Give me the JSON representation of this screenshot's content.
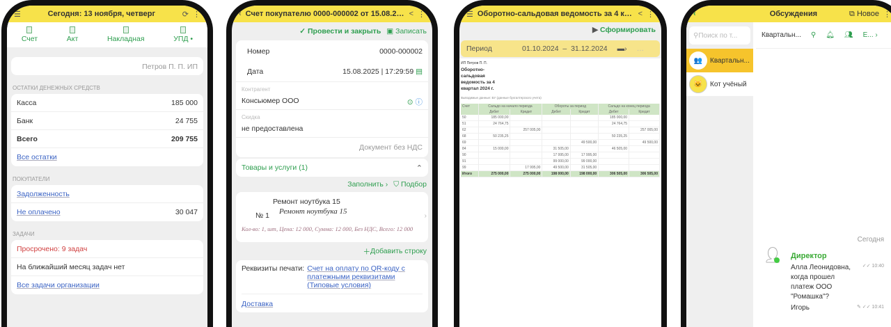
{
  "p1": {
    "title": "Сегодня: 13 ноября, четверг",
    "toolbar": [
      "Счет",
      "Акт",
      "Накладная",
      "УПД •"
    ],
    "org": "Петров П. П. ИП",
    "cash_label": "ОСТАТКИ ДЕНЕЖНЫХ СРЕДСТВ",
    "cash": [
      {
        "k": "Касса",
        "v": "185 000"
      },
      {
        "k": "Банк",
        "v": "24 755"
      },
      {
        "k": "Всего",
        "v": "209 755"
      }
    ],
    "all_balances": "Все остатки",
    "buyers_label": "ПОКУПАТЕЛИ",
    "debt": "Задолженность",
    "unpaid": "Не оплачено",
    "unpaid_v": "30 047",
    "tasks_label": "ЗАДАЧИ",
    "overdue": "Просрочено: 9 задач",
    "none": "На ближайший месяц задач нет",
    "all_tasks": "Все задачи организации"
  },
  "p2": {
    "title": "Счет покупателю 0000-000002 от 15.08.202...",
    "post_close": "Провести и закрыть",
    "save": "Записать",
    "number_label": "Номер",
    "number": "0000-000002",
    "date_label": "Дата",
    "date": "15.08.2025",
    "time": "17:29:59",
    "contractor_label": "Контрагент",
    "contractor": "Консьюмер ООО",
    "discount_label": "Скидка",
    "discount": "не предоставлена",
    "vat": "Документ без НДС",
    "goods": "Товары и услуги (1)",
    "fill": "Заполнить",
    "pick": "Подбор",
    "line_no": "№ 1",
    "item": "Ремонт ноутбука 15",
    "item_italic": "Ремонт ноутбука 15",
    "details": "Кол-во: 1, шт, Цена: 12 000, Сумма: 12 000, Без НДС, Всего: 12 000",
    "add_row": "Добавить строку",
    "print_label": "Реквизиты печати:",
    "print_link": "Счет на оплату по QR-коду с платежными реквизитами (Типовые условия)",
    "delivery": "Доставка"
  },
  "p3": {
    "title": "Оборотно-сальдовая ведомость за 4 кварт...",
    "generate": "Сформировать",
    "period_label": "Период",
    "from": "01.10.2024",
    "dash": "–",
    "to": "31.12.2024",
    "org": "ИП Петров П. П.",
    "report_title": "Оборотно-сальдовая ведомость за 4 квартал 2024 г.",
    "source": "Выводимые данные: БУ (данные бухгалтерского учета)",
    "h_acc": "Счет",
    "h_start": "Сальдо на начало периода",
    "h_turn": "Обороты за период",
    "h_end": "Сальдо на конец периода",
    "h_dt": "Дебет",
    "h_kt": "Кредит",
    "rows": [
      [
        "50",
        "185 000,00",
        "",
        "",
        "",
        "185 000,00",
        ""
      ],
      [
        "51",
        "24 764,75",
        "",
        "",
        "",
        "24 764,75",
        ""
      ],
      [
        "62",
        "",
        "257 005,00",
        "",
        "",
        "",
        "257 005,00"
      ],
      [
        "68",
        "50 235,25",
        "",
        "",
        "",
        "50 235,25",
        ""
      ],
      [
        "69",
        "",
        "",
        "",
        "49 500,00",
        "",
        "49 500,00"
      ],
      [
        "84",
        "15 000,00",
        "",
        "31 505,00",
        "",
        "46 505,00",
        ""
      ],
      [
        "90",
        "",
        "",
        "17 995,00",
        "17 995,00",
        "",
        ""
      ],
      [
        "91",
        "",
        "",
        "99 000,00",
        "99 000,00",
        "",
        ""
      ],
      [
        "99",
        "",
        "17 995,00",
        "49 500,00",
        "31 505,00",
        "",
        ""
      ]
    ],
    "total": [
      "Итого",
      "275 000,00",
      "275 000,00",
      "198 000,00",
      "198 000,00",
      "306 505,00",
      "306 505,00"
    ]
  },
  "p4": {
    "title": "Обсуждения",
    "new": "Новое",
    "search": "Поиск по т...",
    "chat_title": "Квартальн...",
    "more": "Е...",
    "chats": [
      "Квартальн...",
      "Кот учёный"
    ],
    "today": "Сегодня",
    "author": "Директор",
    "msg": "Алла Леонидовна, когда прошел платеж ООО \"Ромашка\"?",
    "time1": "10:40",
    "next_author": "Игорь",
    "time2": "10:41"
  }
}
